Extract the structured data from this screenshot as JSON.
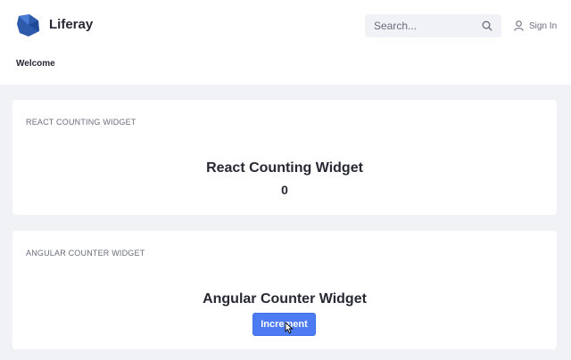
{
  "header": {
    "brand": "Liferay",
    "search_placeholder": "Search...",
    "sign_in": "Sign In",
    "nav": {
      "welcome": "Welcome"
    }
  },
  "portlets": [
    {
      "title": "REACT COUNTING WIDGET",
      "heading": "React Counting Widget",
      "count": "0"
    },
    {
      "title": "ANGULAR COUNTER WIDGET",
      "heading": "Angular Counter Widget",
      "button_label": "Increment"
    }
  ],
  "colors": {
    "accent": "#4d7bf3",
    "logo": "#2e5aac",
    "page_bg": "#f1f2f5"
  },
  "icons": {
    "logo": "liferay-logo-icon",
    "search": "search-icon",
    "user": "user-icon",
    "cursor": "mouse-pointer-icon"
  }
}
